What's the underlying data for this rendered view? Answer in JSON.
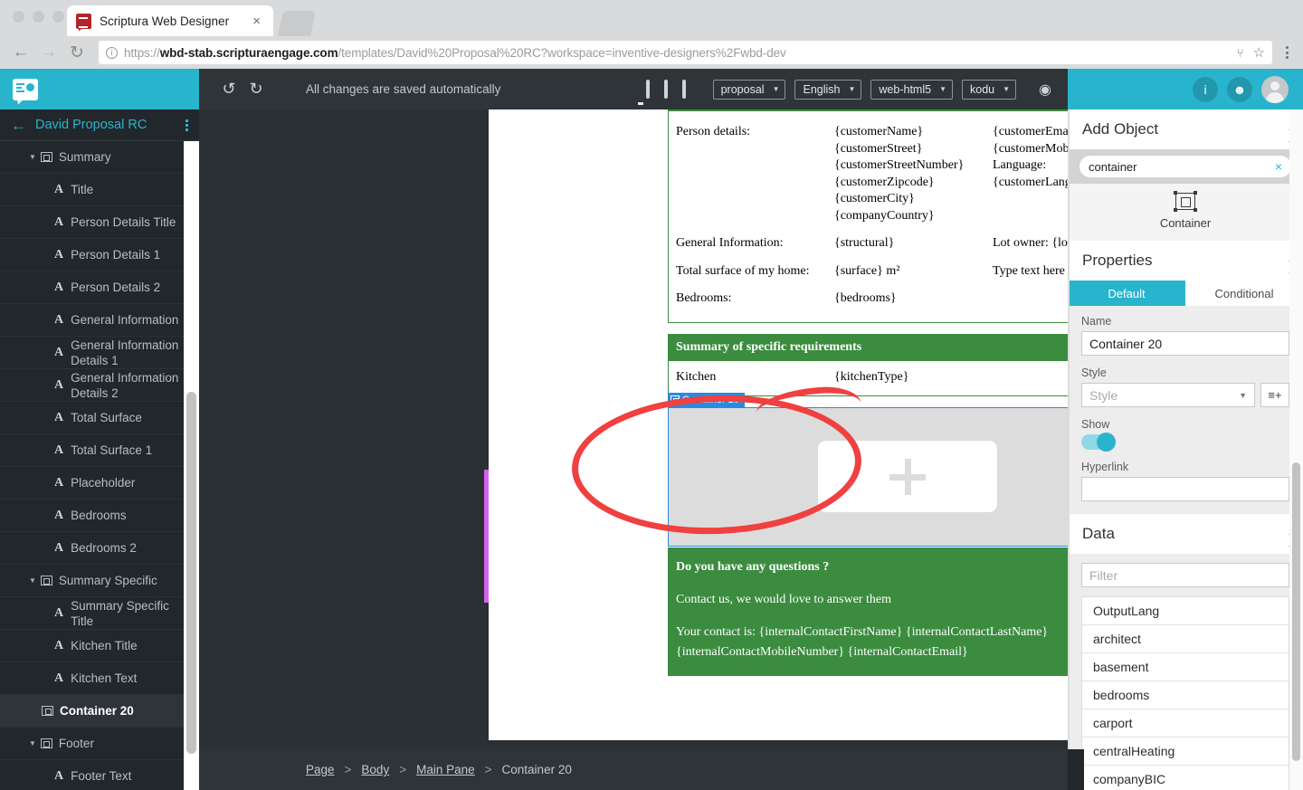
{
  "browser": {
    "tab_title": "Scriptura Web Designer",
    "tab_close": "×",
    "url_scheme": "https://",
    "url_domain": "wbd-stab.scripturaengage.com",
    "url_path": "/templates/David%20Proposal%20RC?workspace=inventive-designers%2Fwbd-dev",
    "back_icon": "←",
    "forward_icon": "→",
    "reload_icon": "↻",
    "info_icon": "i",
    "pilcrow_icon": "⑂",
    "star_icon": "☆"
  },
  "sidebar": {
    "title": "David Proposal RC",
    "back_icon": "←",
    "menu_icon": "kebab-menu",
    "items": [
      {
        "label": "Summary",
        "indent": 1,
        "icon": "container",
        "caret": true,
        "selected": false
      },
      {
        "label": "Title",
        "indent": 3,
        "icon": "text",
        "caret": false,
        "selected": false
      },
      {
        "label": "Person Details Title",
        "indent": 3,
        "icon": "text",
        "caret": false,
        "selected": false
      },
      {
        "label": "Person Details 1",
        "indent": 3,
        "icon": "text",
        "caret": false,
        "selected": false
      },
      {
        "label": "Person Details 2",
        "indent": 3,
        "icon": "text",
        "caret": false,
        "selected": false
      },
      {
        "label": "General Information",
        "indent": 3,
        "icon": "text",
        "caret": false,
        "selected": false
      },
      {
        "label": "General Information Details 1",
        "indent": 3,
        "icon": "text",
        "caret": false,
        "selected": false
      },
      {
        "label": "General Information Details 2",
        "indent": 3,
        "icon": "text",
        "caret": false,
        "selected": false
      },
      {
        "label": "Total Surface",
        "indent": 3,
        "icon": "text",
        "caret": false,
        "selected": false
      },
      {
        "label": "Total Surface 1",
        "indent": 3,
        "icon": "text",
        "caret": false,
        "selected": false
      },
      {
        "label": "Placeholder",
        "indent": 3,
        "icon": "text",
        "caret": false,
        "selected": false
      },
      {
        "label": "Bedrooms",
        "indent": 3,
        "icon": "text",
        "caret": false,
        "selected": false
      },
      {
        "label": "Bedrooms 2",
        "indent": 3,
        "icon": "text",
        "caret": false,
        "selected": false
      },
      {
        "label": "Summary Specific",
        "indent": 1,
        "icon": "container",
        "caret": true,
        "selected": false
      },
      {
        "label": "Summary Specific Title",
        "indent": 3,
        "icon": "text",
        "caret": false,
        "selected": false
      },
      {
        "label": "Kitchen Title",
        "indent": 3,
        "icon": "text",
        "caret": false,
        "selected": false
      },
      {
        "label": "Kitchen Text",
        "indent": 3,
        "icon": "text",
        "caret": false,
        "selected": false
      },
      {
        "label": "Container 20",
        "indent": 2,
        "icon": "container",
        "caret": false,
        "selected": true
      },
      {
        "label": "Footer",
        "indent": 1,
        "icon": "container",
        "caret": true,
        "selected": false
      },
      {
        "label": "Footer Text",
        "indent": 3,
        "icon": "text",
        "caret": false,
        "selected": false
      }
    ]
  },
  "toolbar": {
    "undo_icon": "↺",
    "redo_icon": "↻",
    "status": "All changes are saved automatically",
    "devices": [
      "desktop",
      "tablet",
      "tablet-landscape",
      "phone"
    ],
    "selects": [
      {
        "name": "output-type",
        "value": "proposal"
      },
      {
        "name": "language",
        "value": "English"
      },
      {
        "name": "channel",
        "value": "web-html5"
      },
      {
        "name": "template-user",
        "value": "kodu"
      }
    ],
    "preview_icon": "◉"
  },
  "document": {
    "person_details_label": "Person details:",
    "person_col2": [
      "{customerName}",
      "{customerStreet}",
      " {customerStreetNumber}",
      "{customerZipcode}",
      " {customerCity}",
      "{companyCountry}"
    ],
    "person_col3": [
      "{customerEmail}",
      "{customerMobileNumber}",
      "Language:",
      " {customerLanguage}"
    ],
    "general_label": "General Information:",
    "general_value": "{structural}",
    "general_right": "Lot owner: {lotOwner}",
    "surface_label": "Total surface of my home:",
    "surface_value": "{surface} m²",
    "surface_right": "Type text here",
    "bedrooms_label": "Bedrooms:",
    "bedrooms_value": "{bedrooms}",
    "specific_header": "Summary of specific requirements",
    "kitchen_label": "Kitchen",
    "kitchen_value": "{kitchenType}",
    "container_tag": "Container 20",
    "plus_icon": "+",
    "footer_title": "Do you have any questions ?",
    "footer_line1": "Contact us, we would love to answer them",
    "footer_line2": "Your contact is: {internalContactFirstName} {internalContactLastName}",
    "footer_line3": " {internalContactMobileNumber} {internalContactEmail}",
    "accent_green": "#3b8c3f",
    "selection_blue": "#2b8ae0",
    "annotation_red": "#f04040"
  },
  "breadcrumb": {
    "items": [
      "Page",
      "Body",
      "Main Pane",
      "Container 20"
    ],
    "separator": ">"
  },
  "right_panel": {
    "topbar": {
      "info_icon": "i",
      "bell_icon": "🔔",
      "avatar": "user-avatar"
    },
    "add_object": {
      "title": "Add Object",
      "collapse_icon": "collapse",
      "search_value": "container",
      "clear_icon": "×",
      "result_label": "Container",
      "result_icon": "container-icon"
    },
    "properties": {
      "title": "Properties",
      "collapse_icon": "collapse",
      "tabs": [
        {
          "label": "Default",
          "active": true
        },
        {
          "label": "Conditional",
          "active": false
        }
      ],
      "name_label": "Name",
      "name_value": "Container 20",
      "style_label": "Style",
      "style_placeholder": "Style",
      "style_button_icon": "new-style-icon",
      "show_label": "Show",
      "show_on": true,
      "hyperlink_label": "Hyperlink",
      "hyperlink_value": ""
    },
    "data": {
      "title": "Data",
      "collapse_icon": "collapse",
      "filter_placeholder": "Filter",
      "items": [
        "OutputLang",
        "architect",
        "basement",
        "bedrooms",
        "carport",
        "centralHeating",
        "companyBIC"
      ]
    },
    "accent": "#29b4cd"
  }
}
